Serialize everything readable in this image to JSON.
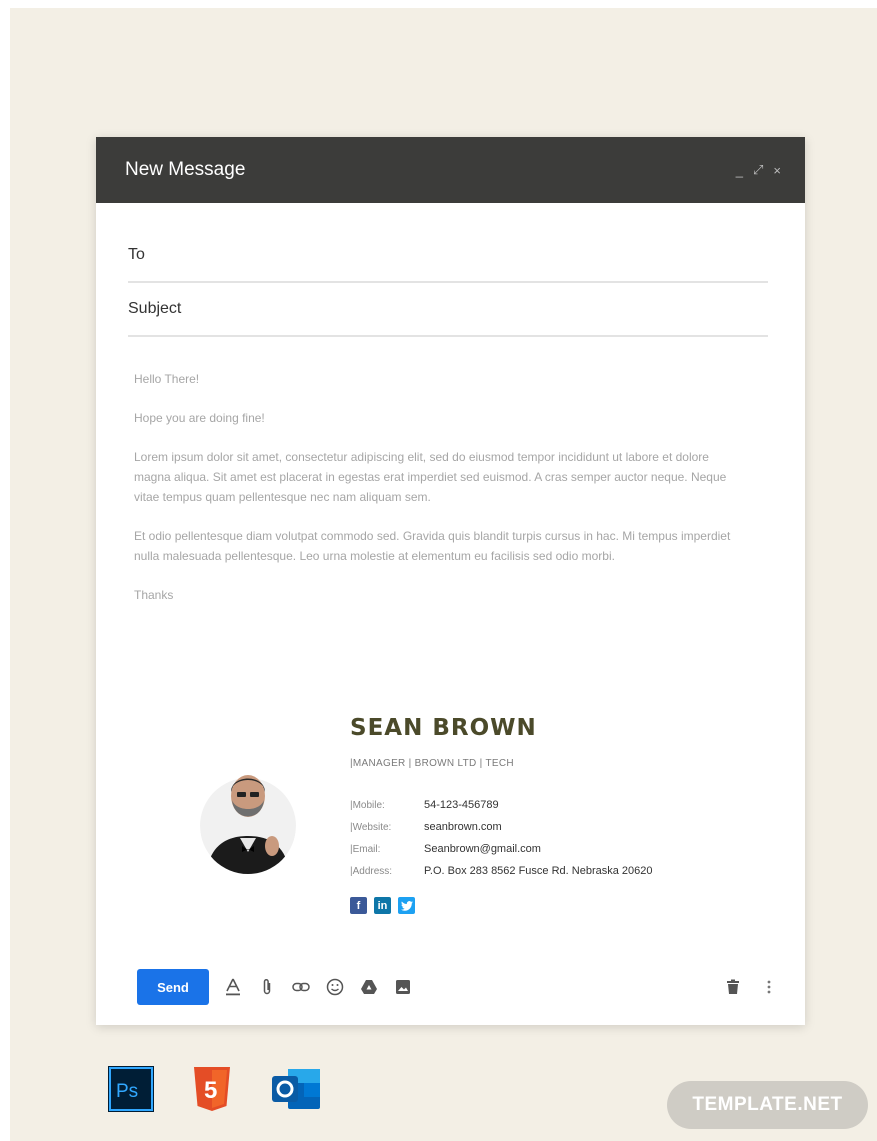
{
  "window": {
    "title": "New Message",
    "controls": {
      "minimize": "_",
      "expand": "⤢",
      "close": "×"
    }
  },
  "fields": {
    "to_label": "To",
    "to_value": "",
    "subject_label": "Subject",
    "subject_value": ""
  },
  "body": {
    "greeting": "Hello There!",
    "line1": "Hope you are doing fine!",
    "paragraph1": "Lorem ipsum dolor sit amet, consectetur adipiscing elit, sed do eiusmod tempor incididunt ut labore et dolore magna aliqua. Sit amet est placerat in egestas erat imperdiet sed euismod. A cras semper auctor neque. Neque vitae tempus quam pellentesque nec nam aliquam sem.",
    "paragraph2": " Et odio pellentesque diam volutpat commodo sed. Gravida quis blandit turpis cursus in hac. Mi tempus imperdiet nulla malesuada pellentesque. Leo urna molestie at elementum eu facilisis sed odio morbi.",
    "closing": "Thanks"
  },
  "signature": {
    "name": "SEAN BROWN",
    "role": "|MANAGER | BROWN LTD | TECH",
    "rows": [
      {
        "key": "|Mobile:",
        "value": "54-123-456789"
      },
      {
        "key": "|Website:",
        "value": "seanbrown.com"
      },
      {
        "key": "|Email:",
        "value": "Seanbrown@gmail.com"
      },
      {
        "key": "|Address:",
        "value": "P.O. Box 283 8562 Fusce Rd. Nebraska 20620"
      }
    ],
    "socials": [
      {
        "icon": "facebook-icon",
        "glyph": "f",
        "color": "#3b5998"
      },
      {
        "icon": "linkedin-icon",
        "glyph": "in",
        "color": "#0e76a8"
      },
      {
        "icon": "twitter-icon",
        "glyph": "t",
        "color": "#1da1f2"
      }
    ]
  },
  "toolbar": {
    "send_label": "Send",
    "send_color": "#1a73e8",
    "tools": [
      "format-text-icon",
      "attach-icon",
      "link-icon",
      "emoji-icon",
      "drive-icon",
      "image-icon"
    ],
    "right_tools": [
      "trash-icon",
      "more-options-icon"
    ]
  },
  "footer": {
    "apps": [
      {
        "icon": "photoshop-icon",
        "label": "Ps"
      },
      {
        "icon": "html5-icon",
        "label": "5"
      },
      {
        "icon": "outlook-icon",
        "label": "O"
      }
    ],
    "badge": "TEMPLATE.NET"
  },
  "colors": {
    "background": "#f3efe5",
    "titlebar": "#3c3c3a",
    "name": "#4b4a2a"
  }
}
